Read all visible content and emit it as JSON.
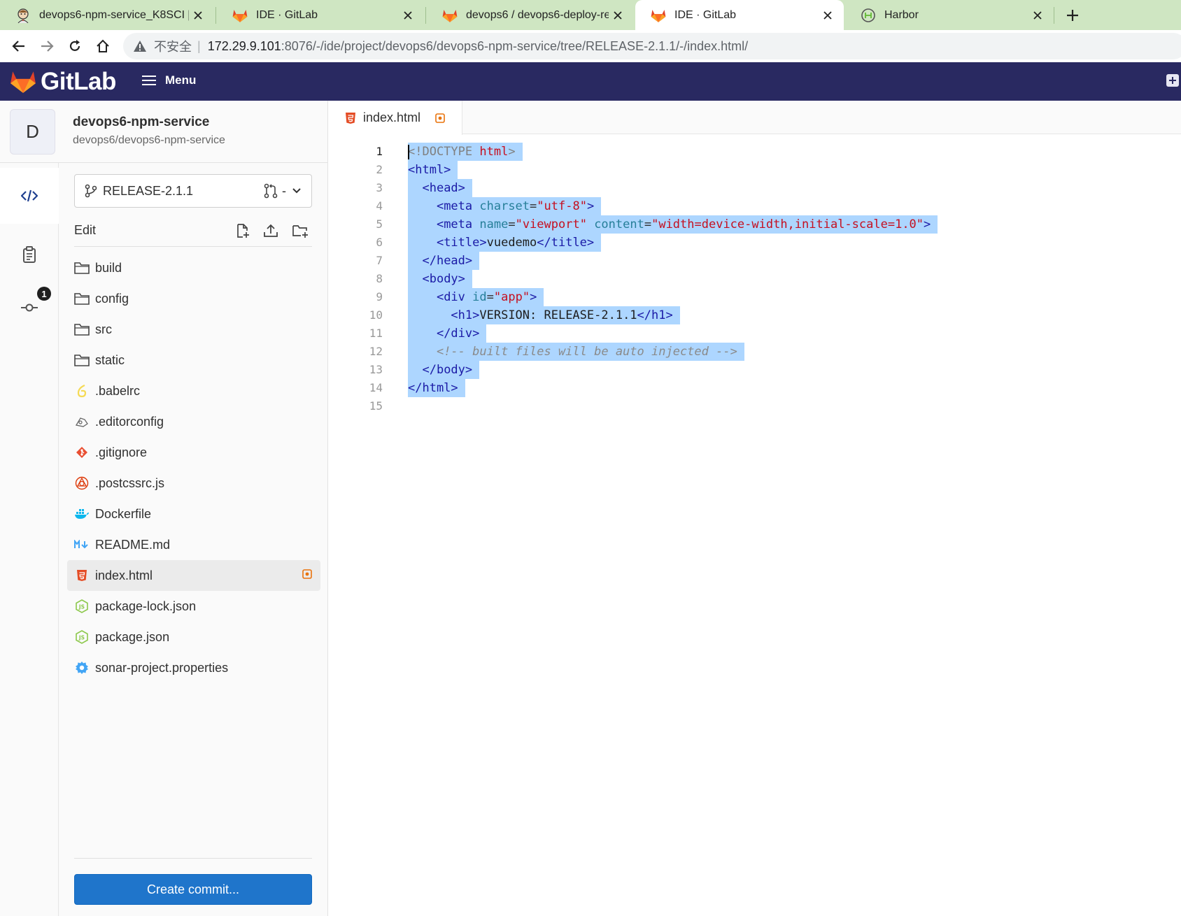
{
  "browser": {
    "tabs": [
      {
        "title": "devops6-npm-service_K8SCI [",
        "icon": "jenkins-icon",
        "active": false
      },
      {
        "title": "IDE · GitLab",
        "icon": "gitlab-icon",
        "active": false
      },
      {
        "title": "devops6 / devops6-deploy-re",
        "icon": "gitlab-icon",
        "active": false
      },
      {
        "title": "IDE · GitLab",
        "icon": "gitlab-icon",
        "active": true
      },
      {
        "title": "Harbor",
        "icon": "harbor-icon",
        "active": false
      }
    ],
    "address": {
      "security_label": "不安全",
      "separator": "|",
      "host": "172.29.9.101",
      "rest": ":8076/-/ide/project/devops6/devops6-npm-service/tree/RELEASE-2.1.1/-/index.html/"
    }
  },
  "gitlab": {
    "wordmark": "GitLab",
    "menu_label": "Menu"
  },
  "project": {
    "avatar_letter": "D",
    "name": "devops6-npm-service",
    "path": "devops6/devops6-npm-service"
  },
  "activity": {
    "commit_badge": "1"
  },
  "sidebar": {
    "branch": "RELEASE-2.1.1",
    "merge_request": "-",
    "edit_label": "Edit",
    "commit_button": "Create commit..."
  },
  "tree": [
    {
      "label": "build",
      "icon": "folder-icon"
    },
    {
      "label": "config",
      "icon": "folder-icon"
    },
    {
      "label": "src",
      "icon": "folder-icon"
    },
    {
      "label": "static",
      "icon": "folder-icon"
    },
    {
      "label": ".babelrc",
      "icon": "babel-icon"
    },
    {
      "label": ".editorconfig",
      "icon": "editorconfig-icon"
    },
    {
      "label": ".gitignore",
      "icon": "git-icon"
    },
    {
      "label": ".postcssrc.js",
      "icon": "postcss-icon"
    },
    {
      "label": "Dockerfile",
      "icon": "docker-icon"
    },
    {
      "label": "README.md",
      "icon": "markdown-icon"
    },
    {
      "label": "index.html",
      "icon": "html5-icon",
      "selected": true,
      "modified": true
    },
    {
      "label": "package-lock.json",
      "icon": "nodejs-icon"
    },
    {
      "label": "package.json",
      "icon": "nodejs-icon"
    },
    {
      "label": "sonar-project.properties",
      "icon": "settings-icon"
    }
  ],
  "editor": {
    "tab_label": "index.html",
    "lines": [
      {
        "n": "1",
        "t": [
          [
            "doc",
            "<!DOCTYPE "
          ],
          [
            "kw",
            "html"
          ],
          [
            "doc",
            ">"
          ]
        ]
      },
      {
        "n": "2",
        "t": [
          [
            "tag",
            "<html>"
          ]
        ]
      },
      {
        "n": "3",
        "t": [
          [
            "txt",
            "  "
          ],
          [
            "tag",
            "<head>"
          ]
        ]
      },
      {
        "n": "4",
        "t": [
          [
            "txt",
            "    "
          ],
          [
            "tag",
            "<meta "
          ],
          [
            "attr",
            "charset"
          ],
          [
            "eq",
            "="
          ],
          [
            "str",
            "\"utf-8\""
          ],
          [
            "tag",
            ">"
          ]
        ]
      },
      {
        "n": "5",
        "t": [
          [
            "txt",
            "    "
          ],
          [
            "tag",
            "<meta "
          ],
          [
            "attr",
            "name"
          ],
          [
            "eq",
            "="
          ],
          [
            "str",
            "\"viewport\""
          ],
          [
            "txt",
            " "
          ],
          [
            "attr",
            "content"
          ],
          [
            "eq",
            "="
          ],
          [
            "str",
            "\"width=device-width,initial-scale=1.0\""
          ],
          [
            "tag",
            ">"
          ]
        ]
      },
      {
        "n": "6",
        "t": [
          [
            "txt",
            "    "
          ],
          [
            "tag",
            "<title>"
          ],
          [
            "txt",
            "vuedemo"
          ],
          [
            "tag",
            "</title>"
          ]
        ]
      },
      {
        "n": "7",
        "t": [
          [
            "txt",
            "  "
          ],
          [
            "tag",
            "</head>"
          ]
        ]
      },
      {
        "n": "8",
        "t": [
          [
            "txt",
            "  "
          ],
          [
            "tag",
            "<body>"
          ]
        ]
      },
      {
        "n": "9",
        "t": [
          [
            "txt",
            "    "
          ],
          [
            "tag",
            "<div "
          ],
          [
            "attr",
            "id"
          ],
          [
            "eq",
            "="
          ],
          [
            "str",
            "\"app\""
          ],
          [
            "tag",
            ">"
          ]
        ]
      },
      {
        "n": "10",
        "t": [
          [
            "txt",
            "      "
          ],
          [
            "tag",
            "<h1>"
          ],
          [
            "txt",
            "VERSION: RELEASE-2.1.1"
          ],
          [
            "tag",
            "</h1>"
          ]
        ]
      },
      {
        "n": "11",
        "t": [
          [
            "txt",
            "    "
          ],
          [
            "tag",
            "</div>"
          ]
        ]
      },
      {
        "n": "12",
        "t": [
          [
            "txt",
            "    "
          ],
          [
            "com",
            "<!-- built files will be auto injected -->"
          ]
        ]
      },
      {
        "n": "13",
        "t": [
          [
            "txt",
            "  "
          ],
          [
            "tag",
            "</body>"
          ]
        ]
      },
      {
        "n": "14",
        "t": [
          [
            "tag",
            "</html>"
          ]
        ]
      },
      {
        "n": "15",
        "t": []
      }
    ]
  },
  "colors": {
    "gitlab_header": "#292961",
    "selection": "#add6ff",
    "primary_button": "#1f75cb",
    "modified_indicator": "#e9730c",
    "tabbar": "#cfe6c2"
  }
}
